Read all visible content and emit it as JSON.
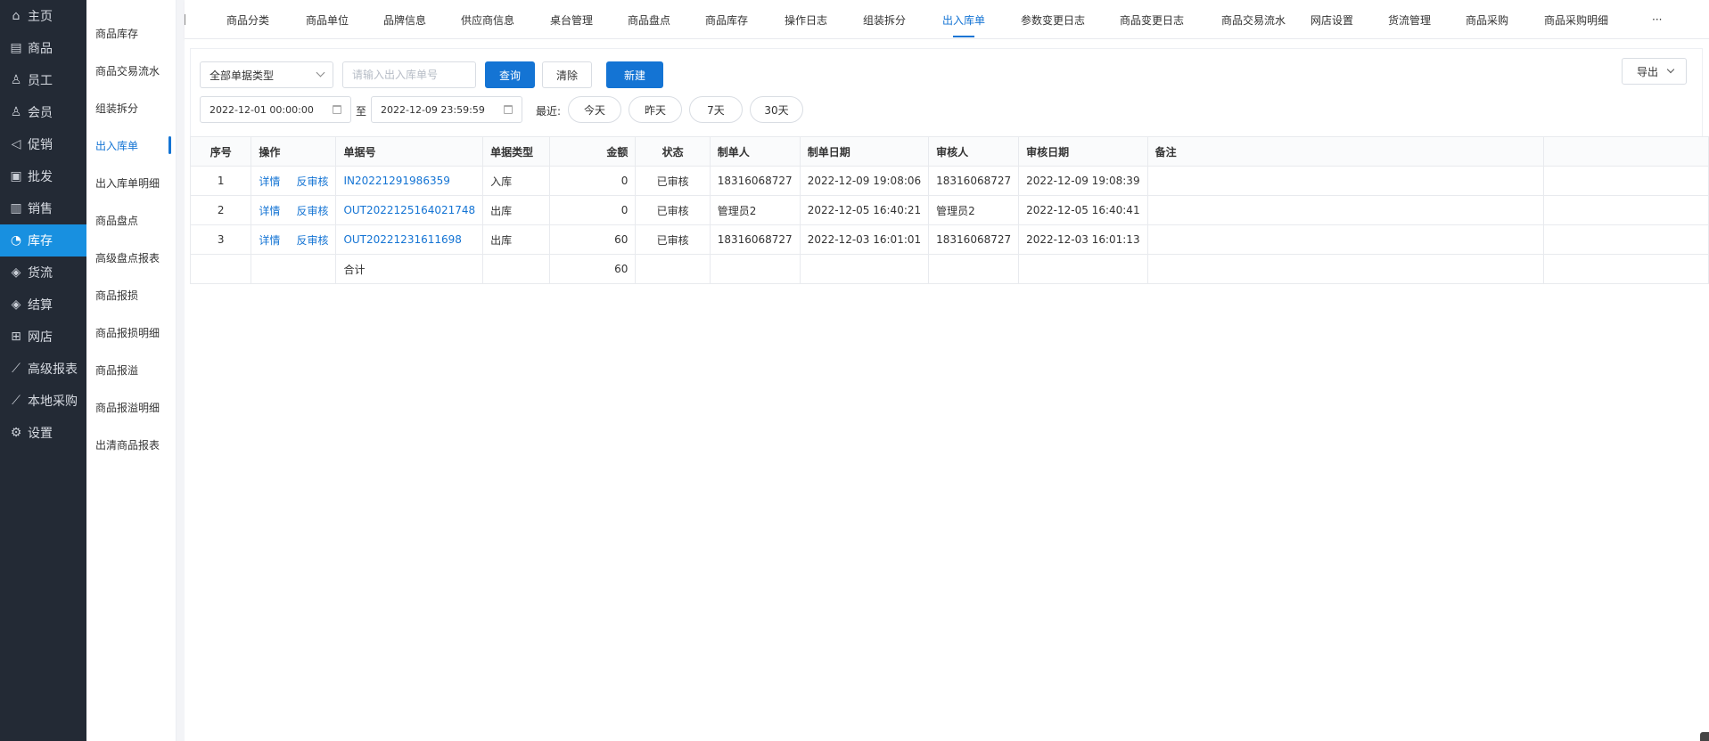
{
  "nav": {
    "items": [
      {
        "label": "主页",
        "icon": "home-icon",
        "glyph": "⌂"
      },
      {
        "label": "商品",
        "icon": "product-icon",
        "glyph": "▤"
      },
      {
        "label": "员工",
        "icon": "staff-icon",
        "glyph": "♙"
      },
      {
        "label": "会员",
        "icon": "member-icon",
        "glyph": "♙"
      },
      {
        "label": "促销",
        "icon": "promotion-icon",
        "glyph": "◁"
      },
      {
        "label": "批发",
        "icon": "wholesale-icon",
        "glyph": "▣"
      },
      {
        "label": "销售",
        "icon": "sales-icon",
        "glyph": "▥"
      },
      {
        "label": "库存",
        "icon": "inventory-icon",
        "glyph": "◔"
      },
      {
        "label": "货流",
        "icon": "logistics-icon",
        "glyph": "◈"
      },
      {
        "label": "结算",
        "icon": "settlement-icon",
        "glyph": "◈"
      },
      {
        "label": "网店",
        "icon": "store-icon",
        "glyph": "⊞"
      },
      {
        "label": "高级报表",
        "icon": "report-icon",
        "glyph": "⟋"
      },
      {
        "label": "本地采购",
        "icon": "purchase-icon",
        "glyph": "⟋"
      },
      {
        "label": "设置",
        "icon": "settings-icon",
        "glyph": "⚙"
      }
    ],
    "active_index": 7
  },
  "subnav": {
    "items": [
      "商品库存",
      "商品交易流水",
      "组装拆分",
      "出入库单",
      "出入库单明细",
      "商品盘点",
      "高级盘点报表",
      "商品报损",
      "商品报损明细",
      "商品报溢",
      "商品报溢明细",
      "出清商品报表"
    ],
    "active_index": 3
  },
  "tabs": {
    "items": [
      "商品分类",
      "商品单位",
      "品牌信息",
      "供应商信息",
      "桌台管理",
      "商品盘点",
      "商品库存",
      "操作日志",
      "组装拆分",
      "出入库单",
      "参数变更日志",
      "商品变更日志",
      "商品交易流水",
      "网店设置",
      "货流管理",
      "商品采购",
      "商品采购明细"
    ],
    "active_index": 9,
    "more": "···"
  },
  "filters": {
    "type_select": "全部单据类型",
    "order_input_value": "",
    "order_input_placeholder": "请输入出入库单号",
    "query_label": "查询",
    "clear_label": "清除",
    "new_label": "新建",
    "export_label": "导出",
    "date_from": "2022-12-01 00:00:00",
    "to_label": "至",
    "date_to": "2022-12-09 23:59:59",
    "recent_label": "最近:",
    "quick_ranges": [
      "今天",
      "昨天",
      "7天",
      "30天"
    ]
  },
  "table": {
    "headers": [
      "序号",
      "操作",
      "单据号",
      "单据类型",
      "金额",
      "状态",
      "制单人",
      "制单日期",
      "审核人",
      "审核日期",
      "备注"
    ],
    "rows": [
      {
        "no": "1",
        "ops": [
          "详情",
          "反审核"
        ],
        "order": "IN20221291986359",
        "type": "入库",
        "amount": "0",
        "status": "已审核",
        "creator": "18316068727",
        "created": "2022-12-09 19:08:06",
        "auditor": "18316068727",
        "audited": "2022-12-09 19:08:39",
        "remark": ""
      },
      {
        "no": "2",
        "ops": [
          "详情",
          "反审核"
        ],
        "order": "OUT2022125164021748",
        "type": "出库",
        "amount": "0",
        "status": "已审核",
        "creator": "管理员2",
        "created": "2022-12-05 16:40:21",
        "auditor": "管理员2",
        "audited": "2022-12-05 16:40:41",
        "remark": ""
      },
      {
        "no": "3",
        "ops": [
          "详情",
          "反审核"
        ],
        "order": "OUT20221231611698",
        "type": "出库",
        "amount": "60",
        "status": "已审核",
        "creator": "18316068727",
        "created": "2022-12-03 16:01:01",
        "auditor": "18316068727",
        "audited": "2022-12-03 16:01:13",
        "remark": ""
      }
    ],
    "total_label": "合计",
    "total_amount": "60"
  },
  "colors": {
    "nav_bg": "#232a35",
    "active_blue": "#1890e0",
    "link_blue": "#1474d4"
  }
}
